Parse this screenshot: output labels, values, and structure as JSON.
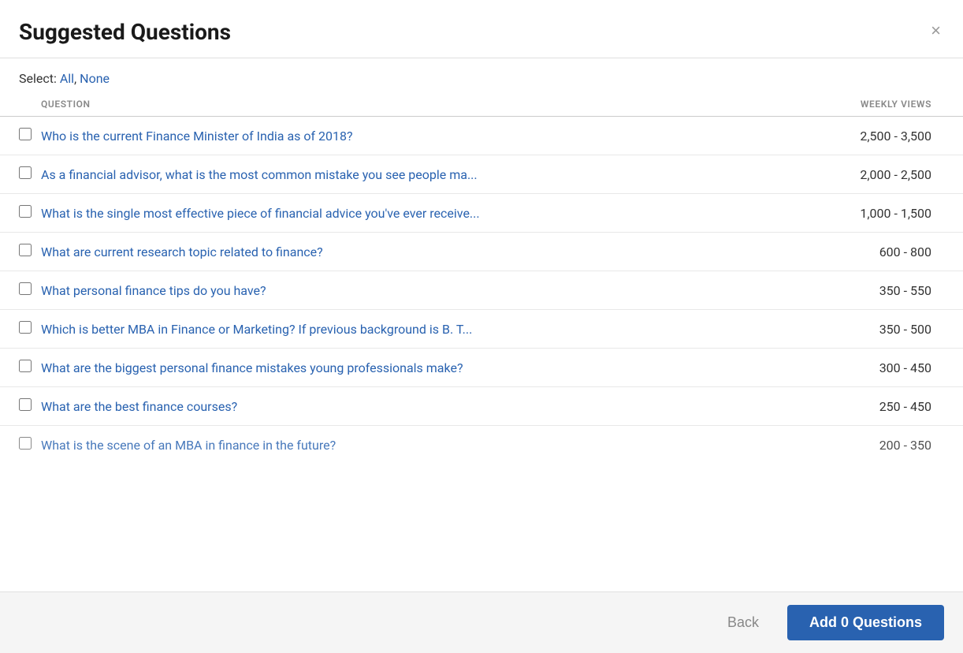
{
  "modal": {
    "title": "Suggested Questions",
    "close_label": "×"
  },
  "select": {
    "label": "Select:",
    "all": "All",
    "none": "None"
  },
  "table": {
    "col_question": "QUESTION",
    "col_views": "WEEKLY VIEWS"
  },
  "questions": [
    {
      "id": 1,
      "text": "Who is the current Finance Minister of India as of 2018?",
      "views": "2,500 - 3,500",
      "checked": false
    },
    {
      "id": 2,
      "text": "As a financial advisor, what is the most common mistake you see people ma...",
      "views": "2,000 - 2,500",
      "checked": false
    },
    {
      "id": 3,
      "text": "What is the single most effective piece of financial advice you've ever receive...",
      "views": "1,000 - 1,500",
      "checked": false
    },
    {
      "id": 4,
      "text": "What are current research topic related to finance?",
      "views": "600 - 800",
      "checked": false
    },
    {
      "id": 5,
      "text": "What personal finance tips do you have?",
      "views": "350 - 550",
      "checked": false
    },
    {
      "id": 6,
      "text": "Which is better MBA in Finance or Marketing? If previous background is B. T...",
      "views": "350 - 500",
      "checked": false
    },
    {
      "id": 7,
      "text": "What are the biggest personal finance mistakes young professionals make?",
      "views": "300 - 450",
      "checked": false
    },
    {
      "id": 8,
      "text": "What are the best finance courses?",
      "views": "250 - 450",
      "checked": false
    },
    {
      "id": 9,
      "text": "What is the scene of an MBA in finance in the future?",
      "views": "200 - 350",
      "checked": false
    }
  ],
  "footer": {
    "back_label": "Back",
    "add_label": "Add 0 Questions"
  }
}
